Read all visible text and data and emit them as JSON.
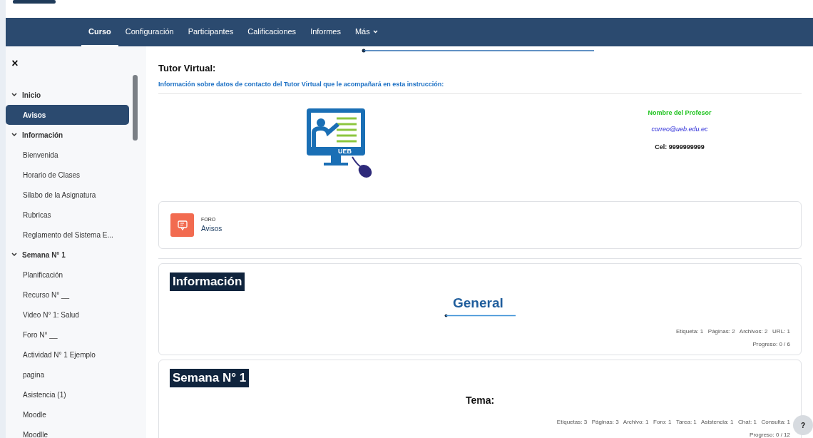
{
  "nav": {
    "tabs": [
      {
        "label": "Curso",
        "selected": true
      },
      {
        "label": "Configuración",
        "selected": false
      },
      {
        "label": "Participantes",
        "selected": false
      },
      {
        "label": "Calificaciones",
        "selected": false
      },
      {
        "label": "Informes",
        "selected": false
      },
      {
        "label": "Más",
        "selected": false,
        "dropdown": true
      }
    ]
  },
  "sidebar": {
    "close": "×",
    "items": [
      {
        "kind": "section",
        "label": "Inicio",
        "selected": false
      },
      {
        "kind": "item",
        "label": "Avisos",
        "selected": true
      },
      {
        "kind": "section",
        "label": "Información",
        "selected": false
      },
      {
        "kind": "item",
        "label": "Bienvenida",
        "selected": false
      },
      {
        "kind": "item",
        "label": "Horario de Clases",
        "selected": false
      },
      {
        "kind": "item",
        "label": "Silabo de la Asignatura",
        "selected": false
      },
      {
        "kind": "item",
        "label": "Rubricas",
        "selected": false
      },
      {
        "kind": "item",
        "label": "Reglamento del Sistema E...",
        "selected": false
      },
      {
        "kind": "section",
        "label": "Semana N° 1",
        "selected": false
      },
      {
        "kind": "item",
        "label": "Planificación",
        "selected": false
      },
      {
        "kind": "item",
        "label": "Recurso N° __",
        "selected": false
      },
      {
        "kind": "item",
        "label": "Video N° 1: Salud",
        "selected": false
      },
      {
        "kind": "item",
        "label": "Foro N° __",
        "selected": false
      },
      {
        "kind": "item",
        "label": "Actividad N° 1 Ejemplo",
        "selected": false
      },
      {
        "kind": "item",
        "label": "pagina",
        "selected": false
      },
      {
        "kind": "item",
        "label": "Asistencia (1)",
        "selected": false
      },
      {
        "kind": "item",
        "label": "Moodle",
        "selected": false
      },
      {
        "kind": "item",
        "label": "Moodlle",
        "selected": false
      }
    ]
  },
  "tutor": {
    "title": "Tutor Virtual:",
    "subtitle": "Información sobre datos de contacto del Tutor Virtual que le acompañará en esta instrucción:",
    "illustration_label": "UEB",
    "name": "Nombre del Profesor",
    "email": "correo@ueb.edu.ec",
    "phone": "Cel: 9999999999"
  },
  "forum": {
    "type": "FORO",
    "name": "Avisos"
  },
  "sections": [
    {
      "title": "Información",
      "subtitle": "General",
      "kind": "banner",
      "stats": "Etiqueta: 1   Páginas: 2   Archivos: 2   URL: 1",
      "progress": "Progreso: 0 / 6"
    },
    {
      "title": "Semana N° 1",
      "subtitle": "Tema:",
      "kind": "heading",
      "stats": "Etiquetas: 3   Páginas: 3   Archivo: 1   Foro: 1   Tarea: 1   Asistencia: 1   Chat: 1   Consulta: 1",
      "progress": "Progreso: 0 / 12"
    }
  ],
  "help": "?"
}
